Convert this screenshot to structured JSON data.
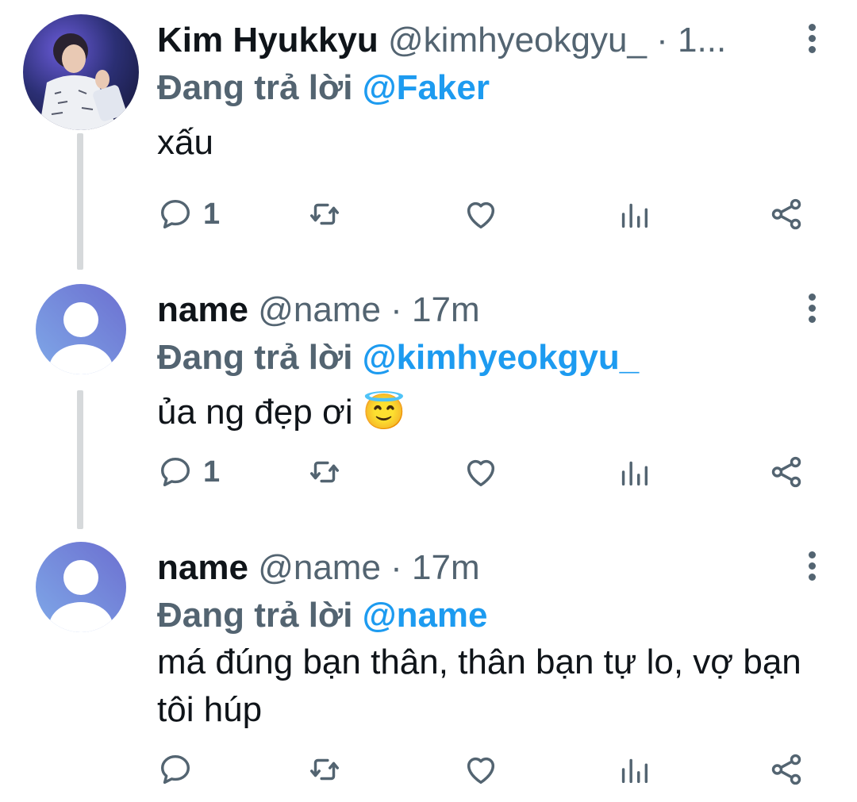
{
  "tweets": [
    {
      "name": "Kim Hyukkyu",
      "handle": "@kimhyeokgyu_",
      "sep": "·",
      "time": "1...",
      "reply_prefix": "Đang trả lời",
      "reply_to": "@Faker",
      "text": "xấu",
      "reply_count": "1",
      "avatar": "profile-photo"
    },
    {
      "name": "name",
      "handle": "@name",
      "sep": "·",
      "time": "17m",
      "reply_prefix": "Đang trả lời",
      "reply_to": "@kimhyeokgyu_",
      "text": "ủa ng đẹp ơi 😇",
      "reply_count": "1",
      "avatar": "default-avatar"
    },
    {
      "name": "name",
      "handle": "@name",
      "sep": "·",
      "time": "17m",
      "reply_prefix": "Đang trả lời",
      "reply_to": "@name",
      "text": "má đúng bạn thân, thân bạn tự lo, vợ bạn tôi húp",
      "reply_count": "",
      "avatar": "default-avatar"
    }
  ],
  "icons": {
    "reply": "speech-bubble-icon",
    "retweet": "retweet-icon",
    "like": "heart-icon",
    "stats": "bar-chart-icon",
    "share": "share-icon",
    "more": "more-vertical-icon"
  },
  "colors": {
    "mention": "#1d9bf0",
    "secondary": "#536471",
    "thread_line": "#d6d9db"
  }
}
